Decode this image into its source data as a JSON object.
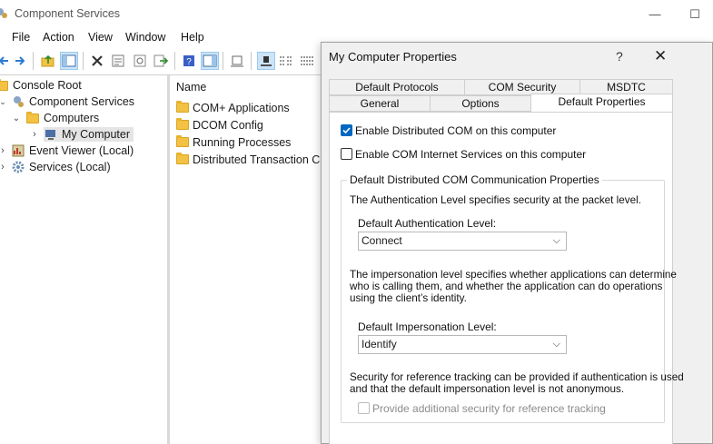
{
  "window": {
    "title": "Component Services",
    "minimize": "—",
    "maximize": "☐"
  },
  "menu": [
    "File",
    "Action",
    "View",
    "Window",
    "Help"
  ],
  "tree": {
    "items": [
      "Console Root",
      "Component Services",
      "Computers",
      "My Computer",
      "Event Viewer (Local)",
      "Services (Local)"
    ]
  },
  "list": {
    "header": "Name",
    "rows": [
      "COM+ Applications",
      "DCOM Config",
      "Running Processes",
      "Distributed Transaction Coo"
    ]
  },
  "dialog": {
    "title": "My Computer Properties",
    "help": "?",
    "close": "✕",
    "tabs_back": [
      "Default Protocols",
      "COM Security",
      "MSDTC"
    ],
    "tabs_front": [
      "General",
      "Options",
      "Default Properties"
    ],
    "enable_dcom": {
      "label": "Enable Distributed COM on this computer",
      "checked": true
    },
    "enable_cis": {
      "label": "Enable COM Internet Services on this computer",
      "checked": false
    },
    "group_title": "Default Distributed COM Communication Properties",
    "auth_desc": "The Authentication Level specifies security at the packet level.",
    "auth_label": "Default Authentication Level:",
    "auth_value": "Connect",
    "imp_desc": [
      "The impersonation level specifies whether applications can determine",
      "who is calling them, and whether the application can do operations",
      "using the client’s identity."
    ],
    "imp_label": "Default Impersonation Level:",
    "imp_value": "Identify",
    "ref_desc": [
      "Security for reference tracking can be provided if authentication is used",
      "and that the default impersonation level is not anonymous."
    ],
    "ref_check": {
      "label": "Provide additional security for reference tracking",
      "checked": false,
      "disabled": true
    }
  },
  "colors": {
    "accent": "#0067c0",
    "selection": "#e5e5e5",
    "folder": "#f3c244"
  }
}
